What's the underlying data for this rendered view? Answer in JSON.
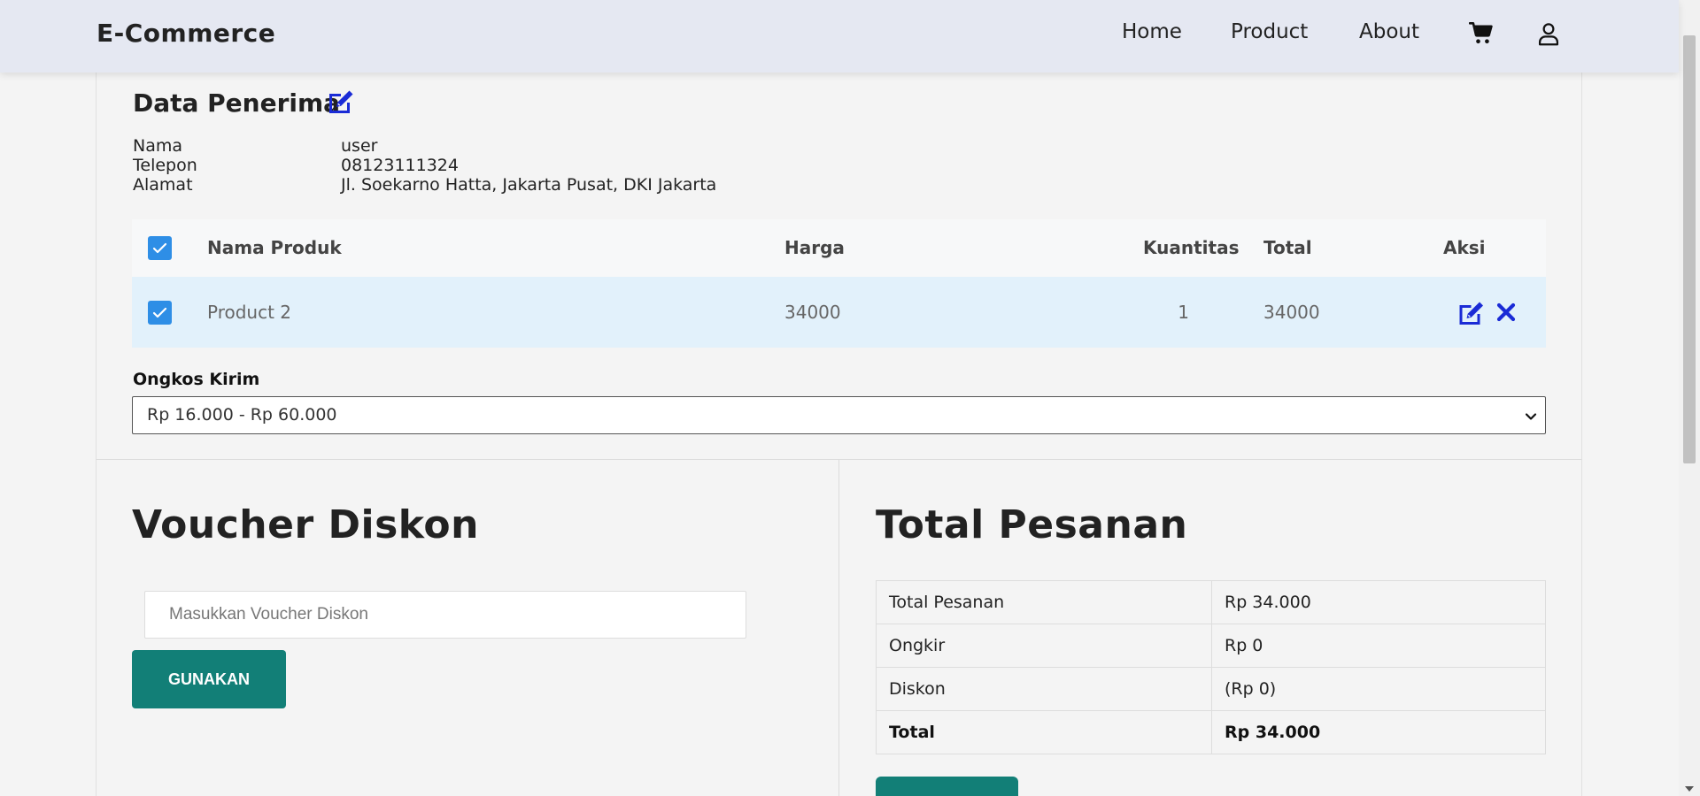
{
  "navbar": {
    "brand": "E-Commerce",
    "links": [
      "Home",
      "Product",
      "About"
    ],
    "icons": [
      "cart-icon",
      "user-icon"
    ]
  },
  "recipient": {
    "title": "Data Penerima",
    "rows": [
      {
        "label": "Nama",
        "value": "user"
      },
      {
        "label": "Telepon",
        "value": "08123111324"
      },
      {
        "label": "Alamat",
        "value": "Jl. Soekarno Hatta, Jakarta Pusat, DKI Jakarta"
      }
    ]
  },
  "cart_table": {
    "headers": [
      "Nama Produk",
      "Harga",
      "Kuantitas",
      "Total",
      "Aksi"
    ],
    "rows": [
      {
        "product": "Product 2",
        "price": "34000",
        "qty": "1",
        "total": "34000",
        "checked": true
      }
    ],
    "select_all_checked": true
  },
  "shipping": {
    "label": "Ongkos Kirim",
    "selected": "Rp 16.000 - Rp 60.000"
  },
  "voucher": {
    "title": "Voucher Diskon",
    "placeholder": "Masukkan Voucher Diskon",
    "button": "GUNAKAN"
  },
  "summary": {
    "title": "Total Pesanan",
    "rows": [
      {
        "label": "Total Pesanan",
        "value": "Rp 34.000"
      },
      {
        "label": "Ongkir",
        "value": "Rp 0"
      },
      {
        "label": "Diskon",
        "value": "(Rp 0)"
      },
      {
        "label": "Total",
        "value": "Rp 34.000"
      }
    ]
  },
  "colors": {
    "accent_blue": "#2e8ee6",
    "icon_blue": "#1a2bd6",
    "button_teal": "#127f77",
    "navbar_bg": "#e5e8f2",
    "row_highlight": "#e2f1fb"
  }
}
